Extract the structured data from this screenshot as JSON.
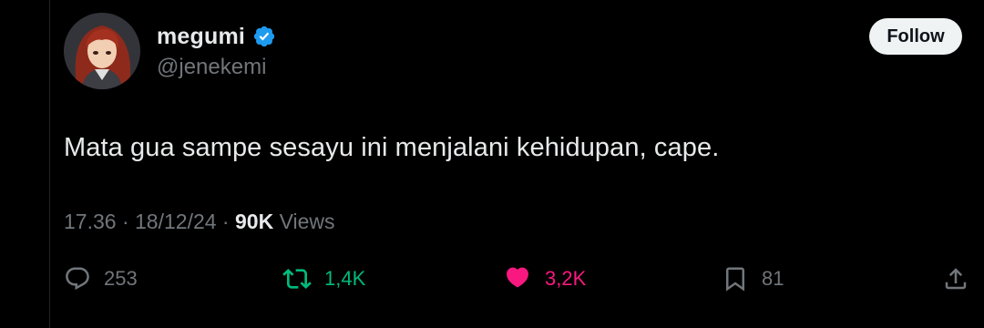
{
  "author": {
    "display_name": "megumi",
    "handle": "@jenekemi",
    "verified": true,
    "avatar": "anime-girl-red-hair-avatar"
  },
  "follow_button": {
    "label": "Follow"
  },
  "tweet": {
    "text": "Mata gua sampe sesayu ini menjalani kehidupan, cape.",
    "time": "17.36",
    "separator": " · ",
    "date": "18/12/24",
    "views_count": "90K",
    "views_label": " Views"
  },
  "actions": {
    "reply": {
      "icon": "reply-icon",
      "count": "253"
    },
    "retweet": {
      "icon": "retweet-icon",
      "count": "1,4K",
      "active": true
    },
    "like": {
      "icon": "heart-icon",
      "count": "3,2K",
      "active": true
    },
    "bookmark": {
      "icon": "bookmark-icon",
      "count": "81"
    },
    "share": {
      "icon": "share-icon"
    }
  },
  "colors": {
    "background": "#000000",
    "text_primary": "#e7e9ea",
    "text_secondary": "#71767b",
    "verified_blue": "#1d9bf0",
    "retweet_green": "#00ba7c",
    "like_pink": "#f91880",
    "follow_button_bg": "#eff3f4"
  }
}
